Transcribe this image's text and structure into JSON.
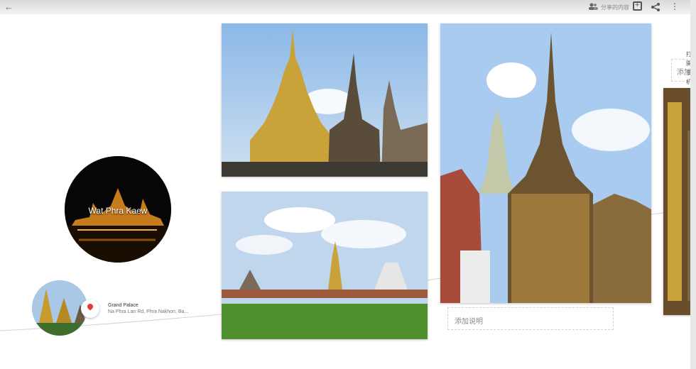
{
  "toolbar": {
    "back_icon": "arrow-left-icon",
    "share_label": "分享的内容",
    "people_icon": "people-icon",
    "add_icon": "add-photo-icon",
    "share_icon": "share-icon",
    "more_icon": "more-vert-icon"
  },
  "featured": {
    "title": "Wat Phra Kaew"
  },
  "location": {
    "name": "Grand Palace",
    "address": "Na Phra Lan Rd, Phra Nakhon, Ba...",
    "pin_icon": "map-pin-icon"
  },
  "captions": {
    "add_caption": "添加说明",
    "add_caption_partial": "添加"
  },
  "edge_text": [
    "打開",
    "于机",
    "号",
    "成"
  ],
  "colors": {
    "pin": "#e53935",
    "toolbar": "#e9e9e9"
  }
}
